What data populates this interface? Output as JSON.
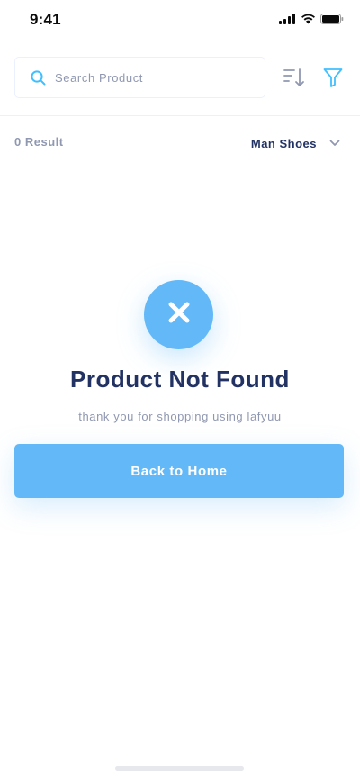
{
  "status_bar": {
    "time": "9:41",
    "icons": [
      "cellular-signal-icon",
      "wifi-icon",
      "battery-icon"
    ]
  },
  "search": {
    "placeholder": "Search Product",
    "value": "",
    "icon": "search-icon"
  },
  "toolbar": {
    "sort_icon": "sort-icon",
    "filter_icon": "filter-icon"
  },
  "results": {
    "count_label": "0 Result",
    "category": "Man Shoes",
    "category_icon": "chevron-down-icon"
  },
  "empty_state": {
    "icon": "close-icon",
    "title": "Product Not Found",
    "subtitle": "thank you for shopping using lafyuu",
    "button_label": "Back to Home"
  },
  "colors": {
    "primary": "#63b8f7",
    "title": "#223263",
    "muted": "#9098b1",
    "border": "#ebf0ff"
  }
}
